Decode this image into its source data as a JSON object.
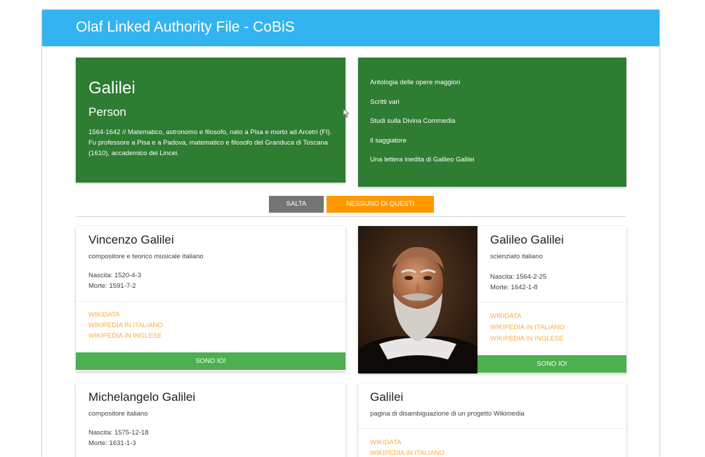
{
  "app": {
    "title": "Olaf Linked Authority File - CoBiS"
  },
  "hero": {
    "name": "Galilei",
    "type": "Person",
    "description": "1564-1642 // Matematico, astronomo e filosofo, nato a Pisa e morto ad Arcetri (FI). Fu professore a Pisa e a Padova, matematico e filosofo del Granduca di Toscana (1610), accademico dei Lincei."
  },
  "works": [
    "Antologia delle opere maggiori",
    "Scritti vari",
    "Studi sulla Divina Commedia",
    "Il saggiatore",
    "Una lettera inedita di Galileo Galilei"
  ],
  "actions": {
    "skip": "SALTA",
    "none": "NESSUNO DI QUESTI"
  },
  "candidates": [
    {
      "name": "Vincenzo Galilei",
      "description": "compositore e teorico musicale italiano",
      "birth": "Nascita: 1520-4-3",
      "death": "Morte: 1591-7-2",
      "links": [
        "WIKIDATA",
        "WIKIPEDIA IN ITALIANO",
        "WIKIPEDIA IN INGLESE"
      ],
      "select": "SONO IO!"
    },
    {
      "name": "Galileo Galilei",
      "description": "scienziato italiano",
      "birth": "Nascita: 1564-2-25",
      "death": "Morte: 1642-1-8",
      "links": [
        "WIKIDATA",
        "WIKIPEDIA IN ITALIANO",
        "WIKIPEDIA IN INGLESE"
      ],
      "select": "SONO IO!",
      "has_image": true
    },
    {
      "name": "Michelangelo Galilei",
      "description": "compositore italiano",
      "birth": "Nascita: 1575-12-18",
      "death": "Morte: 1631-1-3"
    },
    {
      "name": "Galilei",
      "description": "pagina di disambiguazione di un progetto Wikimedia",
      "links": [
        "WIKIDATA",
        "WIKIPEDIA IN ITALIANO"
      ]
    }
  ],
  "colors": {
    "topbar": "#33b3f0",
    "hero": "#2e7d32",
    "accept": "#4caf50",
    "skip": "#757575",
    "none": "#ff9800",
    "link": "#ffab40"
  }
}
